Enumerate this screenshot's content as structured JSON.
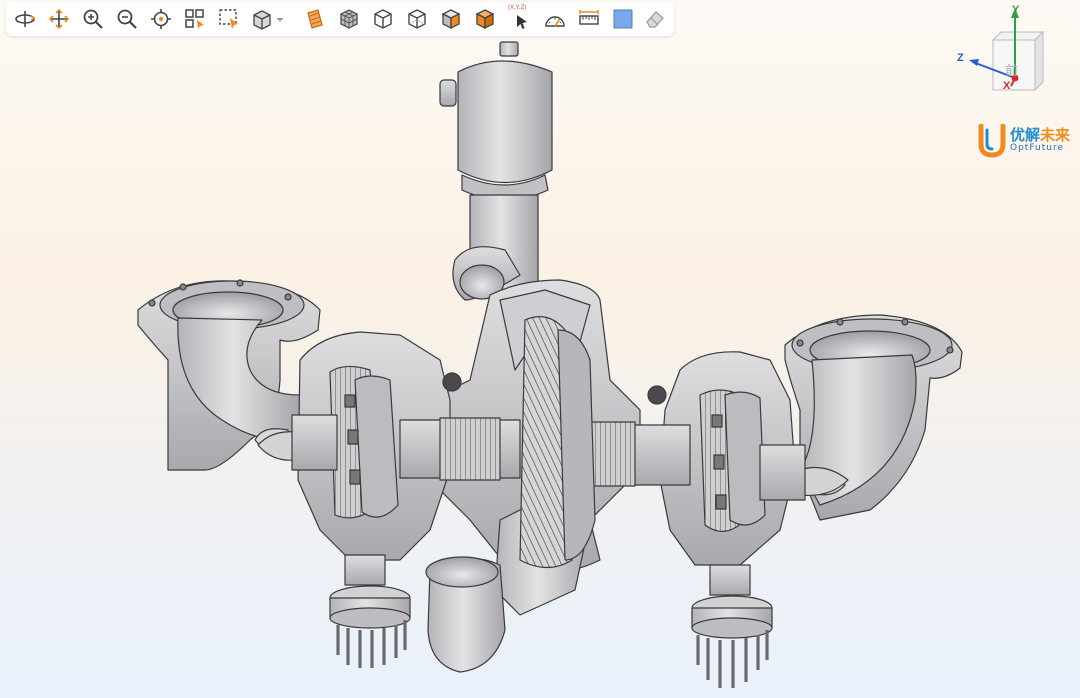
{
  "toolbar": {
    "items": [
      {
        "icon": "rotate-icon"
      },
      {
        "icon": "pan-icon"
      },
      {
        "icon": "zoom-in-icon"
      },
      {
        "icon": "zoom-out-icon"
      },
      {
        "icon": "center-target-icon"
      },
      {
        "icon": "zoom-all-icon"
      },
      {
        "icon": "zoom-window-icon"
      },
      {
        "icon": "view-cube-dropdown-icon"
      },
      {
        "icon": "section-plane-icon"
      },
      {
        "icon": "wireframe-icon"
      },
      {
        "icon": "shaded-edges-icon"
      },
      {
        "icon": "hidden-line-icon"
      },
      {
        "icon": "shaded-icon"
      },
      {
        "icon": "orange-shaded-icon"
      },
      {
        "icon": "coordinate-pick-icon"
      },
      {
        "icon": "angle-measure-icon"
      },
      {
        "icon": "distance-measure-icon"
      },
      {
        "icon": "background-color-icon"
      },
      {
        "icon": "eraser-icon"
      }
    ],
    "coord_pick_label": "(X,Y,Z)"
  },
  "triad": {
    "y_label": "Y",
    "z_label": "Z",
    "x_label": "X",
    "cube_front_label": "前"
  },
  "logo": {
    "cn_part1": "优解",
    "cn_part2": "未来",
    "en": "OptFuture"
  },
  "colors": {
    "model_fill": "#c9c9cc",
    "model_dark": "#8e8e93",
    "model_edge": "#3a3a3d",
    "accent_orange": "#f08a1f",
    "axis_y": "#2aa33a",
    "axis_z": "#2a5bd6",
    "axis_x": "#d42a2a"
  }
}
